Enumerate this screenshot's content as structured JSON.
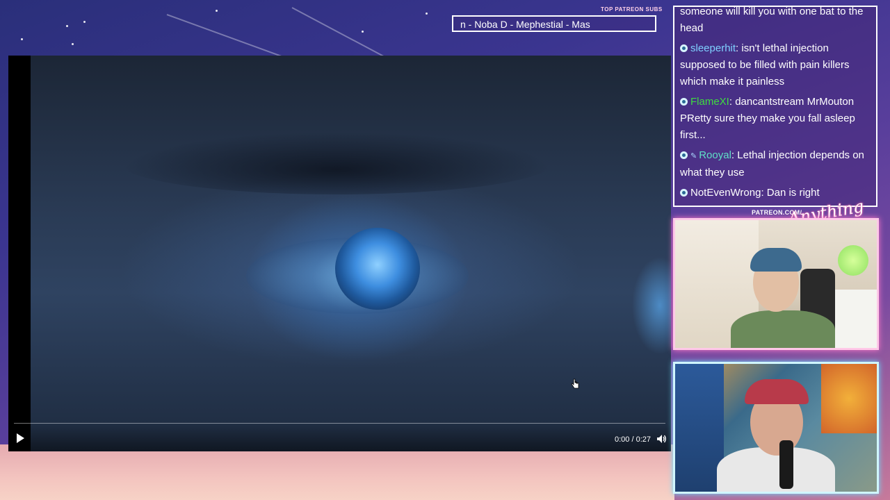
{
  "ticker": {
    "label": "TOP PATREON SUBS",
    "text": "n -  Noba D - Mephestial - Mas"
  },
  "player": {
    "time": "0:00 / 0:27",
    "play_icon": "play-icon",
    "volume_icon": "volume-icon",
    "progress": 0
  },
  "chat": {
    "messages": [
      {
        "user": "",
        "text": "someone will kill you with one bat to the head",
        "color": "#ffffff"
      },
      {
        "user": "sleeperhit",
        "text": ": isn't lethal injection supposed to be filled with pain killers which make it painless",
        "color": "#7fd0ff"
      },
      {
        "user": "FlameXI",
        "text": ": dancantstream MrMouton PRetty sure they make you fall asleep first...",
        "color": "#3fdc3f"
      },
      {
        "user": "Rooyal",
        "text": ": Lethal injection depends on what they use",
        "color": "#5fe0c8"
      },
      {
        "user": "NotEvenWrong",
        "text": ": Dan is right",
        "color": "#ffffff"
      }
    ]
  },
  "patreon": {
    "label": "PATREON.COM/",
    "logo": "Anything Else"
  },
  "colors": {
    "cam1_border": "#ffc8e8",
    "cam2_border": "#d0f6ff",
    "chat_border": "#ffffff"
  }
}
